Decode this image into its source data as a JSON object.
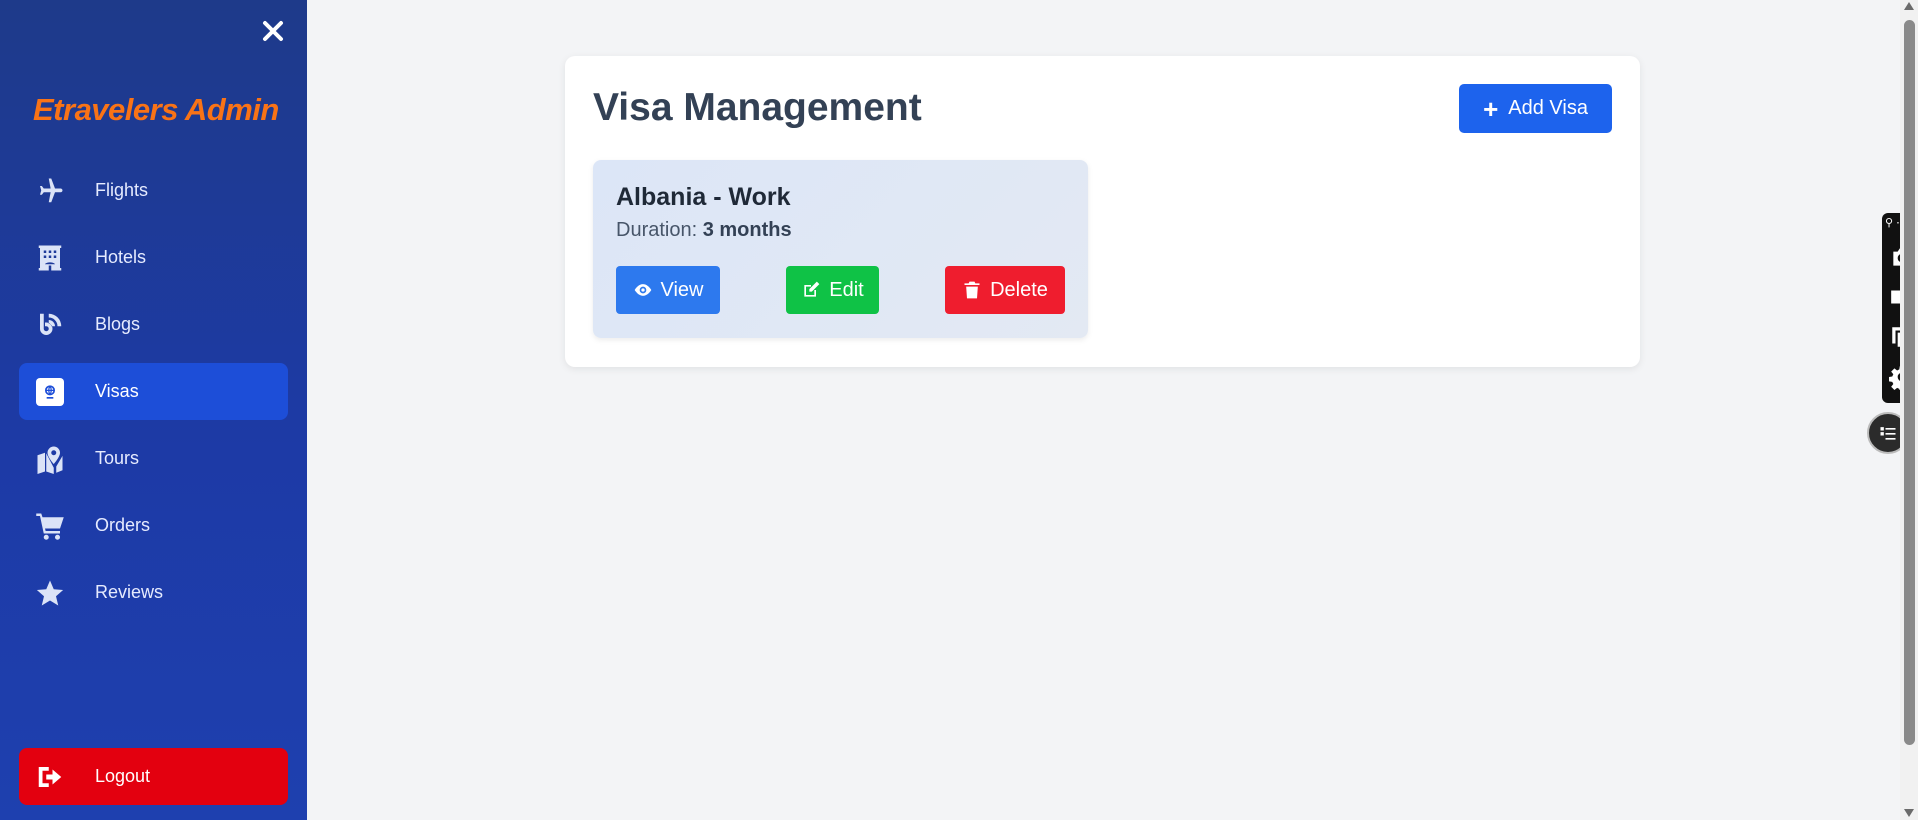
{
  "sidebar": {
    "brand": "Etravelers Admin",
    "items": [
      {
        "label": "Flights",
        "icon": "plane-icon",
        "active": false
      },
      {
        "label": "Hotels",
        "icon": "hotel-icon",
        "active": false
      },
      {
        "label": "Blogs",
        "icon": "blog-icon",
        "active": false
      },
      {
        "label": "Visas",
        "icon": "passport-icon",
        "active": true
      },
      {
        "label": "Tours",
        "icon": "map-icon",
        "active": false
      },
      {
        "label": "Orders",
        "icon": "cart-icon",
        "active": false
      },
      {
        "label": "Reviews",
        "icon": "star-icon",
        "active": false
      }
    ],
    "logout_label": "Logout"
  },
  "main": {
    "title": "Visa Management",
    "add_button_label": "Add Visa",
    "visas": [
      {
        "title": "Albania - Work",
        "duration_label": "Duration:",
        "duration_value": "3 months",
        "view_label": "View",
        "edit_label": "Edit",
        "delete_label": "Delete"
      }
    ]
  },
  "colors": {
    "sidebar_bg": "#1e3a8a",
    "brand": "#f97316",
    "active_item": "#1d4ed8",
    "logout": "#e3000f",
    "primary": "#1d63ed",
    "view": "#2d79ee",
    "edit": "#0fc246",
    "delete": "#ef1d2e"
  }
}
